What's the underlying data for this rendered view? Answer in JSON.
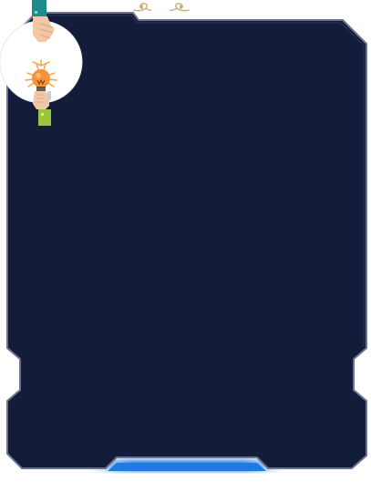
{
  "card": {
    "background_color": "#131d3a",
    "border_color": "#8a93ad",
    "accent_color": "#1f7be0",
    "ornament_color": "#c8aa6e"
  },
  "illustration": {
    "icons": [
      "hand-holding-lightbulb-icon",
      "lightbulb-icon",
      "hand-reaching-icon"
    ],
    "circle_color": "#ffffff",
    "bulb_color": "#f6923a",
    "upper_sleeve_color": "#1f8a8a",
    "lower_sleeve_color": "#9cc43a"
  },
  "divider": {
    "icons": [
      "left-swirl-ornament-icon",
      "right-swirl-ornament-icon"
    ]
  }
}
